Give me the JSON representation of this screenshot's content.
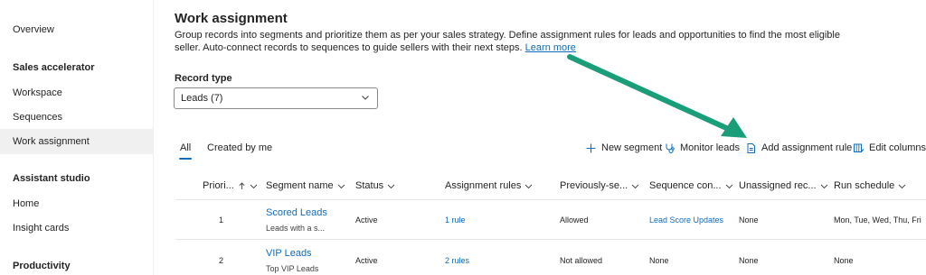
{
  "sidebar": {
    "overview": "Overview",
    "sales_accelerator_heading": "Sales accelerator",
    "workspace": "Workspace",
    "sequences": "Sequences",
    "work_assignment": "Work assignment",
    "assistant_studio_heading": "Assistant studio",
    "home": "Home",
    "insight_cards": "Insight cards",
    "productivity_heading": "Productivity"
  },
  "main": {
    "title": "Work assignment",
    "description": "Group records into segments and prioritize them as per your sales strategy. Define assignment rules for leads and opportunities to find the most eligible seller. Auto-connect records to sequences to guide sellers with their next steps.",
    "learn_more": "Learn more",
    "record_type_label": "Record type",
    "record_type_value": "Leads (7)"
  },
  "tabs": {
    "all": "All",
    "created_by_me": "Created by me"
  },
  "toolbar": {
    "new_segment": "New segment",
    "monitor_leads": "Monitor leads",
    "add_assignment_rule": "Add assignment rule",
    "edit_columns": "Edit columns"
  },
  "table": {
    "columns": {
      "priority": "Priori...",
      "segment_name": "Segment name",
      "status": "Status",
      "assignment_rules": "Assignment rules",
      "previously": "Previously-se...",
      "sequence": "Sequence con...",
      "unassigned": "Unassigned rec...",
      "run_schedule": "Run schedule"
    },
    "rows": [
      {
        "priority": "1",
        "name": "Scored Leads",
        "sub": "Leads with a s...",
        "status": "Active",
        "rules": "1 rule",
        "previously": "Allowed",
        "sequence": "Lead Score Updates",
        "unassigned": "None",
        "schedule": "Mon, Tue, Wed, Thu, Fri"
      },
      {
        "priority": "2",
        "name": "VIP Leads",
        "sub": "Top VIP Leads",
        "status": "Active",
        "rules": "2 rules",
        "previously": "Not allowed",
        "sequence": "None",
        "unassigned": "None",
        "schedule": "None"
      }
    ]
  },
  "colors": {
    "accent": "#0f6cbd",
    "arrow": "#1a9e7a",
    "selected_nav": "#f0f0f0"
  }
}
